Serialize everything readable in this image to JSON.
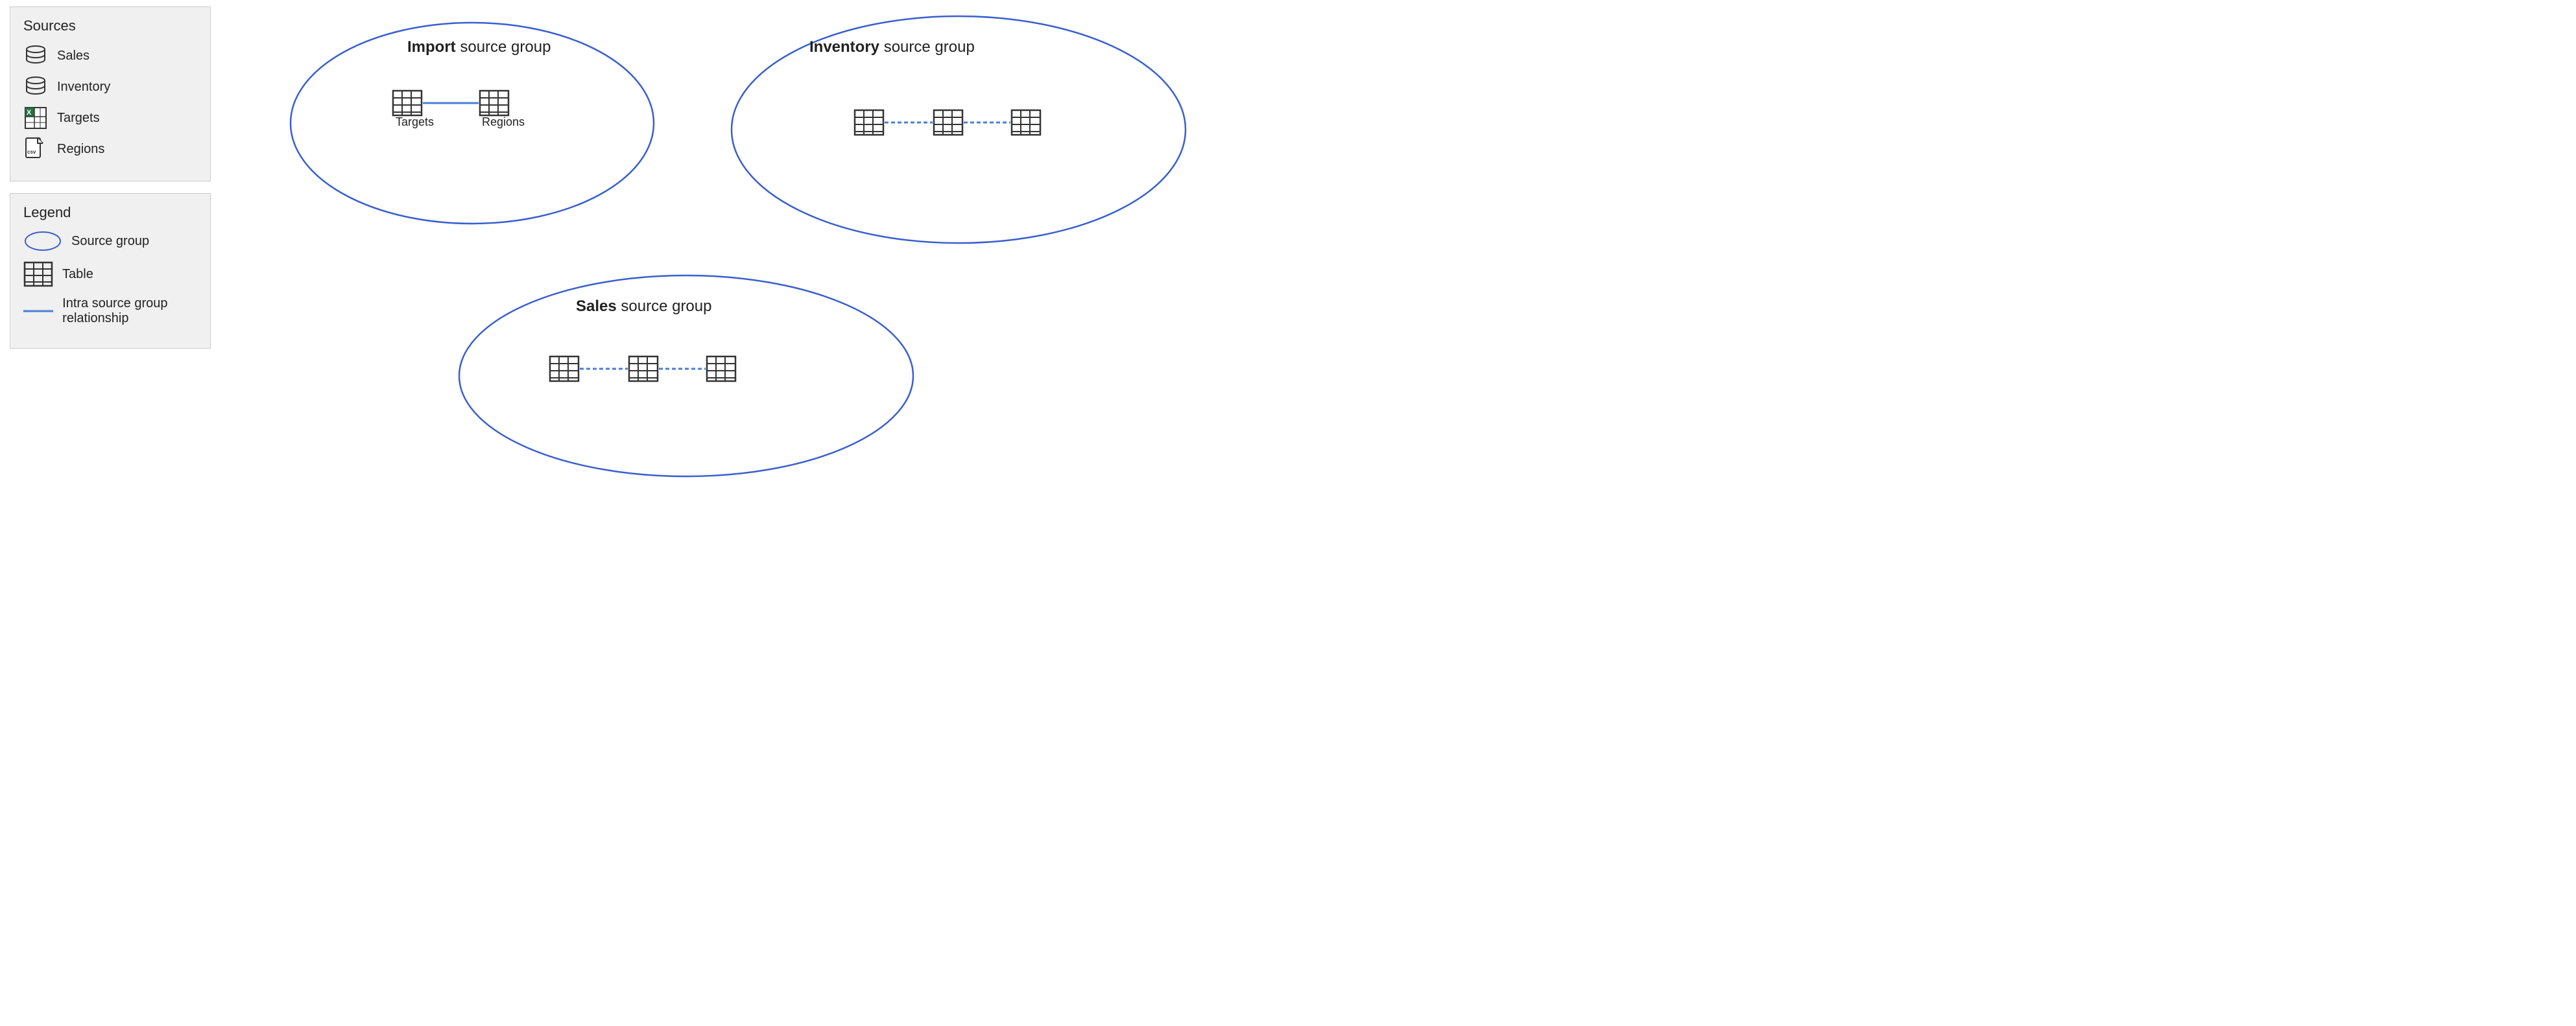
{
  "sources": {
    "title": "Sources",
    "items": [
      {
        "id": "sales",
        "label": "Sales",
        "icon": "database"
      },
      {
        "id": "inventory",
        "label": "Inventory",
        "icon": "database"
      },
      {
        "id": "targets",
        "label": "Targets",
        "icon": "excel"
      },
      {
        "id": "regions",
        "label": "Regions",
        "icon": "csv"
      }
    ]
  },
  "legend": {
    "title": "Legend",
    "items": [
      {
        "id": "source-group",
        "label": "Source group",
        "icon": "oval"
      },
      {
        "id": "table",
        "label": "Table",
        "icon": "table"
      },
      {
        "id": "relationship",
        "label": "Intra source group relationship",
        "icon": "line"
      }
    ]
  },
  "groups": {
    "import": {
      "title_bold": "Import",
      "title_rest": " source group",
      "tables": [
        "Targets",
        "Regions"
      ]
    },
    "inventory": {
      "title_bold": "Inventory",
      "title_rest": " source group",
      "tables": [
        "",
        "",
        ""
      ]
    },
    "sales": {
      "title_bold": "Sales",
      "title_rest": " source group",
      "tables": [
        "",
        "",
        ""
      ]
    }
  },
  "colors": {
    "ellipse_stroke": "#3a5fcd",
    "connector": "#4a7fd4",
    "text": "#222222",
    "panel_bg": "#f0f0f0"
  }
}
